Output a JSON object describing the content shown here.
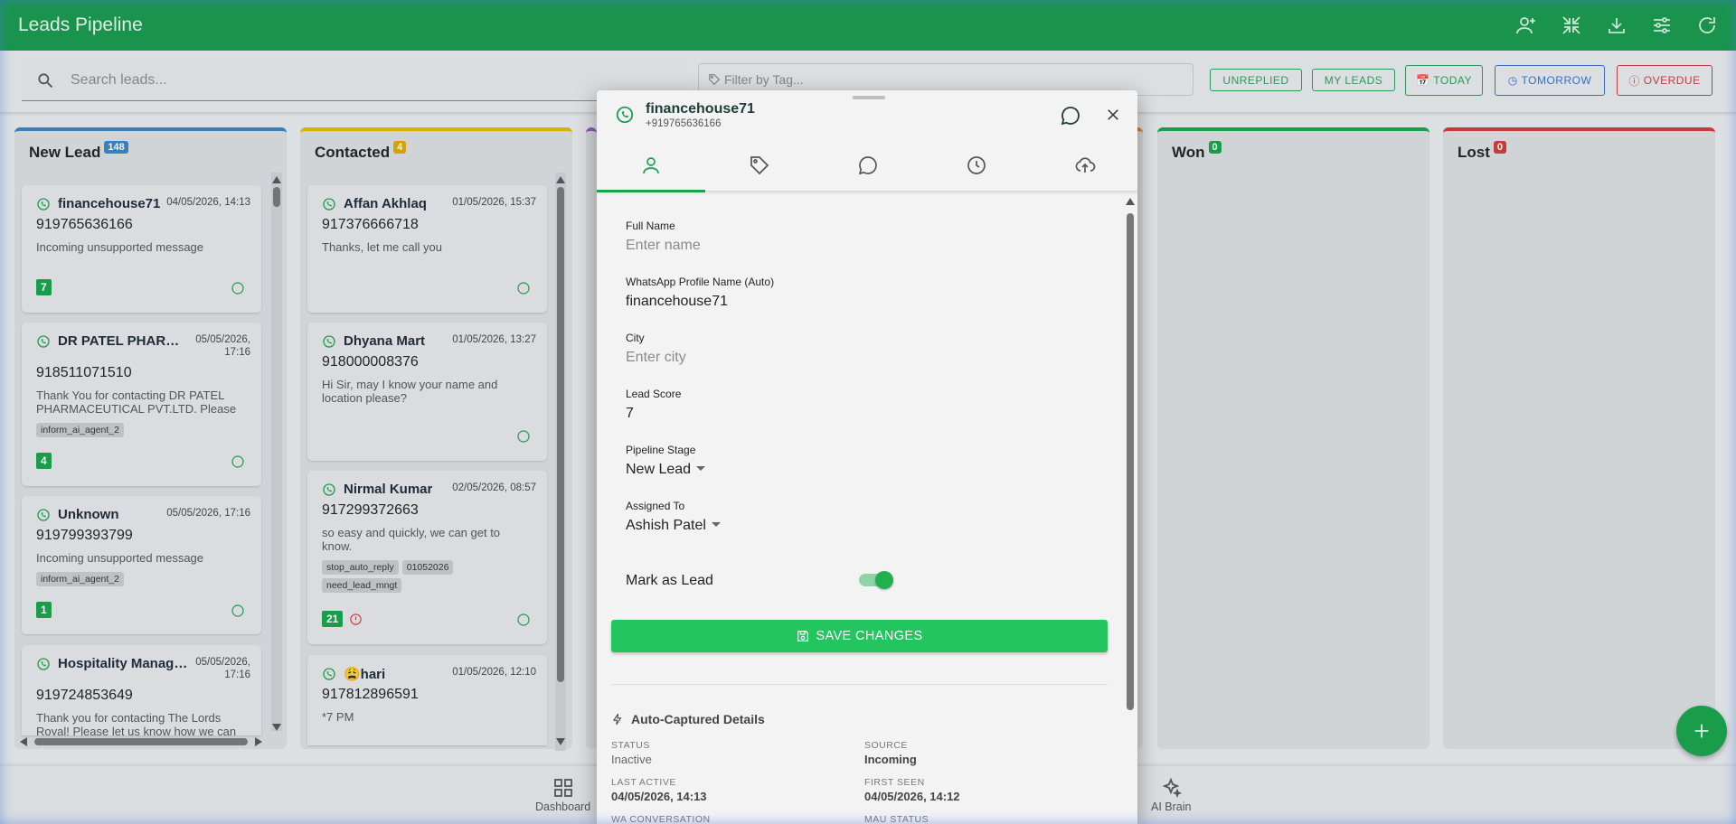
{
  "app": {
    "title": "Leads Pipeline"
  },
  "search": {
    "placeholder": "Search leads..."
  },
  "tag_filter": {
    "placeholder": "Filter by Tag..."
  },
  "quick_filters": {
    "unreplied": "UNREPLIED",
    "my_leads": "MY LEADS",
    "today": "TODAY",
    "tomorrow": "TOMORROW",
    "overdue": "OVERDUE"
  },
  "colors": {
    "brand": "#1a9a4c",
    "accent": "#22c55e",
    "new_lead": "#3b82c4",
    "contacted": "#e8b400",
    "won": "#1aa34a",
    "lost": "#d23a3a"
  },
  "columns": [
    {
      "name": "New Lead",
      "count": "148"
    },
    {
      "name": "Contacted",
      "count": "4"
    },
    {
      "name": "Won",
      "count": "0"
    },
    {
      "name": "Lost",
      "count": "0"
    }
  ],
  "new_lead_cards": [
    {
      "name": "financehouse71",
      "date": "04/05/2026, 14:13",
      "phone": "919765636166",
      "message": "Incoming unsupported message",
      "score": "7"
    },
    {
      "name": "DR PATEL PHARMACEUTICAL",
      "date_line1": "05/05/2026,",
      "date_line2": "17:16",
      "phone": "918511071510",
      "message": "Thank You for contacting DR PATEL PHARMACEUTICAL PVT.LTD. Please let us know",
      "tags": [
        "inform_ai_agent_2"
      ],
      "score": "4"
    },
    {
      "name": "Unknown",
      "date": "05/05/2026, 17:16",
      "phone": "919799393799",
      "message": "Incoming unsupported message",
      "tags": [
        "inform_ai_agent_2"
      ],
      "score": "1"
    },
    {
      "name": "Hospitality Management",
      "date_line1": "05/05/2026,",
      "date_line2": "17:16",
      "phone": "919724853649",
      "message": "Thank you for contacting The Lords Royal! Please let us know how we can help"
    }
  ],
  "contacted_cards": [
    {
      "name": "Affan Akhlaq",
      "date": "01/05/2026, 15:37",
      "phone": "917376666718",
      "message": "Thanks, let me call you"
    },
    {
      "name": "Dhyana Mart",
      "date": "01/05/2026, 13:27",
      "phone": "918000008376",
      "message": "Hi Sir, may I know your name and location please?"
    },
    {
      "name": "Nirmal Kumar",
      "date": "02/05/2026, 08:57",
      "phone": "917299372663",
      "message": "so easy and quickly, we can get to know.",
      "tags": [
        "stop_auto_reply",
        "01052026",
        "need_lead_mngt"
      ],
      "score": "21"
    },
    {
      "name": "😩hari",
      "date": "01/05/2026, 12:10",
      "phone": "917812896591",
      "message": "*7 PM"
    }
  ],
  "bottom_nav": {
    "dashboard": "Dashboard",
    "ai_brain": "AI Brain"
  },
  "dialog": {
    "name": "financehouse71",
    "phone": "+919765636166",
    "fields": {
      "full_name_label": "Full Name",
      "full_name_placeholder": "Enter name",
      "wa_profile_label": "WhatsApp Profile Name (Auto)",
      "wa_profile_value": "financehouse71",
      "city_label": "City",
      "city_placeholder": "Enter city",
      "lead_score_label": "Lead Score",
      "lead_score_value": "7",
      "pipeline_stage_label": "Pipeline Stage",
      "pipeline_stage_value": "New Lead",
      "assigned_to_label": "Assigned To",
      "assigned_to_value": "Ashish Patel",
      "mark_as_lead_label": "Mark as Lead",
      "mark_as_lead_on": true
    },
    "save_label": "SAVE CHANGES",
    "auto_captured": {
      "title": "Auto-Captured Details",
      "status_label": "STATUS",
      "status_value": "Inactive",
      "source_label": "SOURCE",
      "source_value": "Incoming",
      "last_active_label": "LAST ACTIVE",
      "last_active_value": "04/05/2026, 14:13",
      "first_seen_label": "FIRST SEEN",
      "first_seen_value": "04/05/2026, 14:12",
      "wa_conversation_label": "WA CONVERSATION",
      "mau_status_label": "MAU STATUS"
    }
  }
}
